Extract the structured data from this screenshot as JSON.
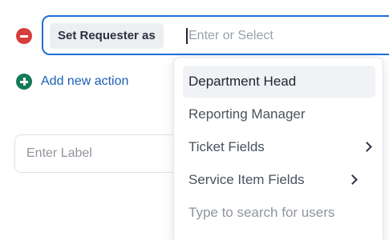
{
  "action": {
    "chip_label": "Set Requester as",
    "input_placeholder": "Enter or Select"
  },
  "add_action": {
    "label": "Add new action",
    "icon": "plus-circle-icon"
  },
  "remove_action": {
    "icon": "minus-circle-icon"
  },
  "label_field": {
    "placeholder": "Enter Label"
  },
  "dropdown": {
    "items": [
      {
        "label": "Department Head",
        "has_submenu": false,
        "highlighted": true
      },
      {
        "label": "Reporting Manager",
        "has_submenu": false,
        "highlighted": false
      },
      {
        "label": "Ticket Fields",
        "has_submenu": true,
        "highlighted": false
      },
      {
        "label": "Service Item Fields",
        "has_submenu": true,
        "highlighted": false
      }
    ],
    "hint": "Type to search for users"
  },
  "colors": {
    "focus_border": "#1f6fd6",
    "remove_red": "#d63d3d",
    "add_green": "#157a56",
    "link_blue": "#1a5fb4"
  }
}
